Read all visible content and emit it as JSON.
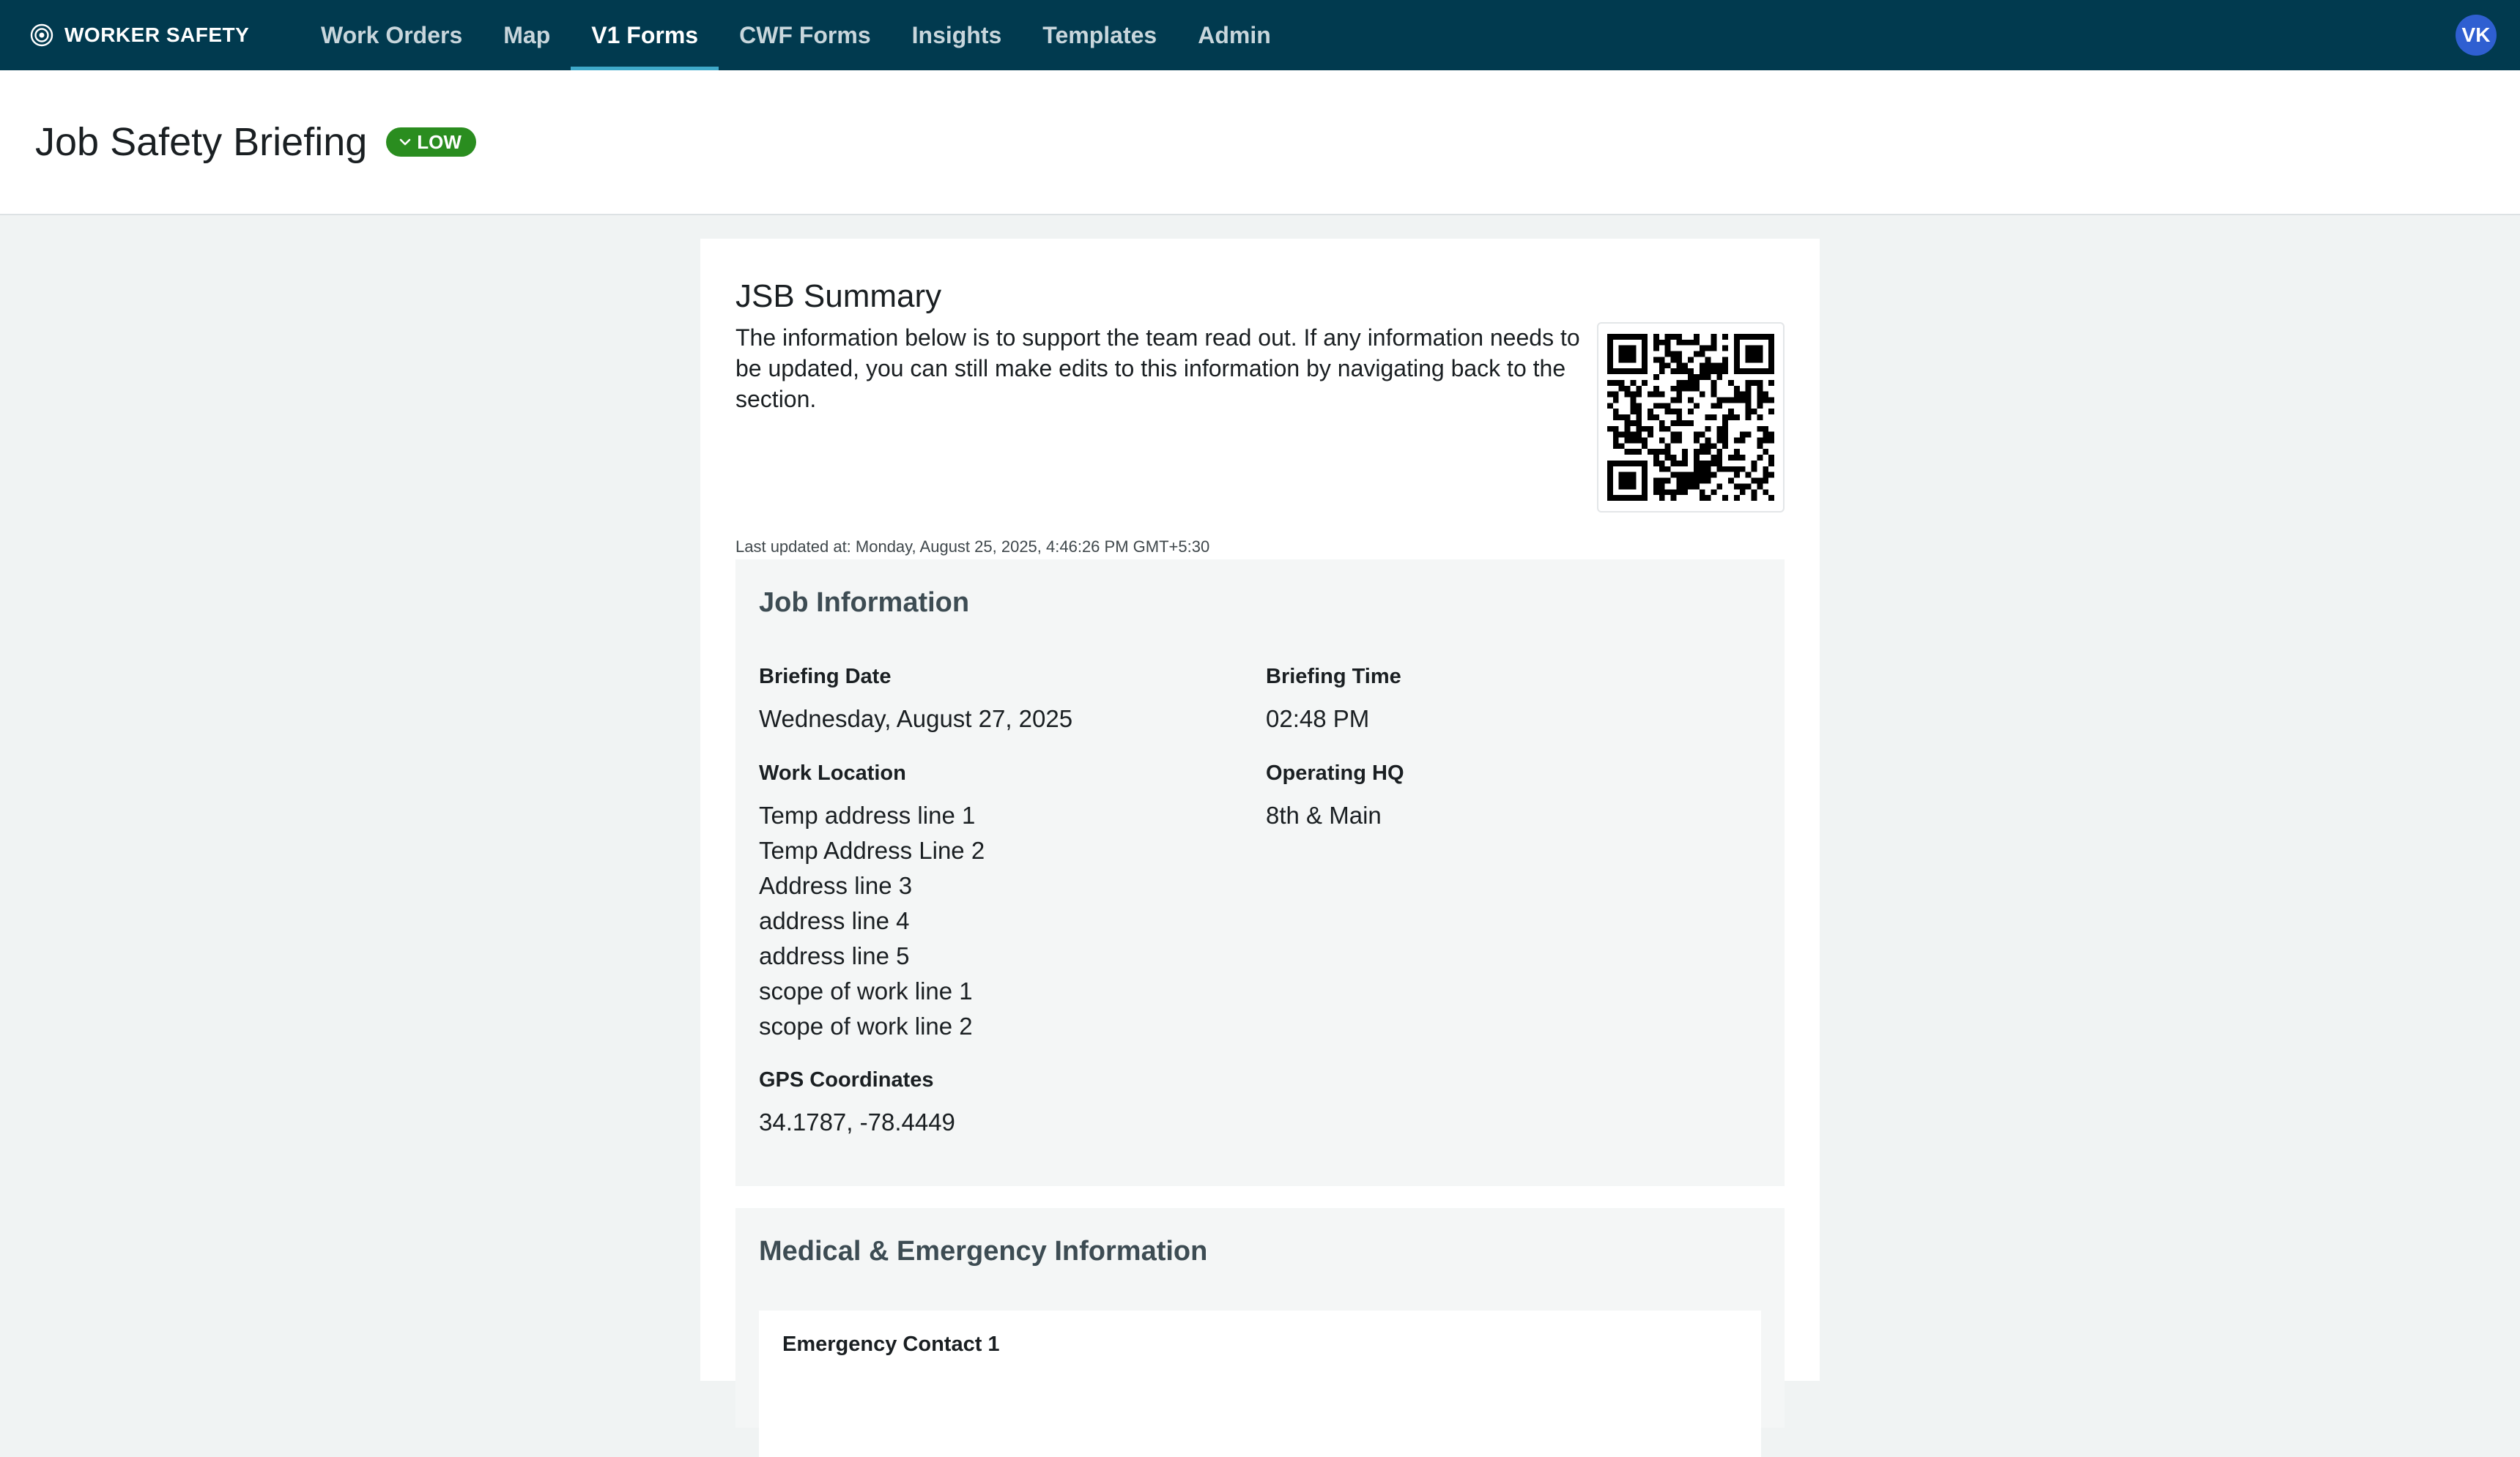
{
  "nav": {
    "brand": "WORKER SAFETY",
    "links": [
      {
        "label": "Work Orders"
      },
      {
        "label": "Map"
      },
      {
        "label": "V1 Forms"
      },
      {
        "label": "CWF Forms"
      },
      {
        "label": "Insights"
      },
      {
        "label": "Templates"
      },
      {
        "label": "Admin"
      }
    ],
    "active_link": "V1 Forms",
    "avatar_initials": "VK"
  },
  "page": {
    "title": "Job Safety Briefing",
    "risk_badge": "LOW",
    "risk_badge_icon": "chevron-down-icon",
    "risk_color": "#2a8d1f"
  },
  "summary": {
    "title": "JSB Summary",
    "description": "The information below is to support the team read out. If any information needs to be updated, you can still make edits to this information by navigating back to the section.",
    "qr_icon": "qr-code-icon",
    "last_updated": "Last updated at: Monday, August 25, 2025, 4:46:26 PM GMT+5:30"
  },
  "job_information": {
    "title": "Job Information",
    "briefing_date_label": "Briefing Date",
    "briefing_date": "Wednesday, August 27, 2025",
    "briefing_time_label": "Briefing Time",
    "briefing_time": "02:48 PM",
    "work_location_label": "Work Location",
    "work_location_lines": [
      "Temp address line 1",
      "Temp Address Line 2",
      "Address line 3",
      "address line 4",
      "address line 5",
      "scope of work line 1",
      "scope of work line 2"
    ],
    "operating_hq_label": "Operating HQ",
    "operating_hq": "8th & Main",
    "gps_label": "GPS Coordinates",
    "gps": "34.1787, -78.4449"
  },
  "medical": {
    "title": "Medical & Emergency Information",
    "contact_1_label": "Emergency Contact 1"
  },
  "colors": {
    "nav_bg": "#013a4f",
    "page_bg": "#f0f3f3",
    "section_bg": "#f4f6f6",
    "avatar_bg": "#2f5fd1",
    "active_underline": "#3fa9c9"
  }
}
